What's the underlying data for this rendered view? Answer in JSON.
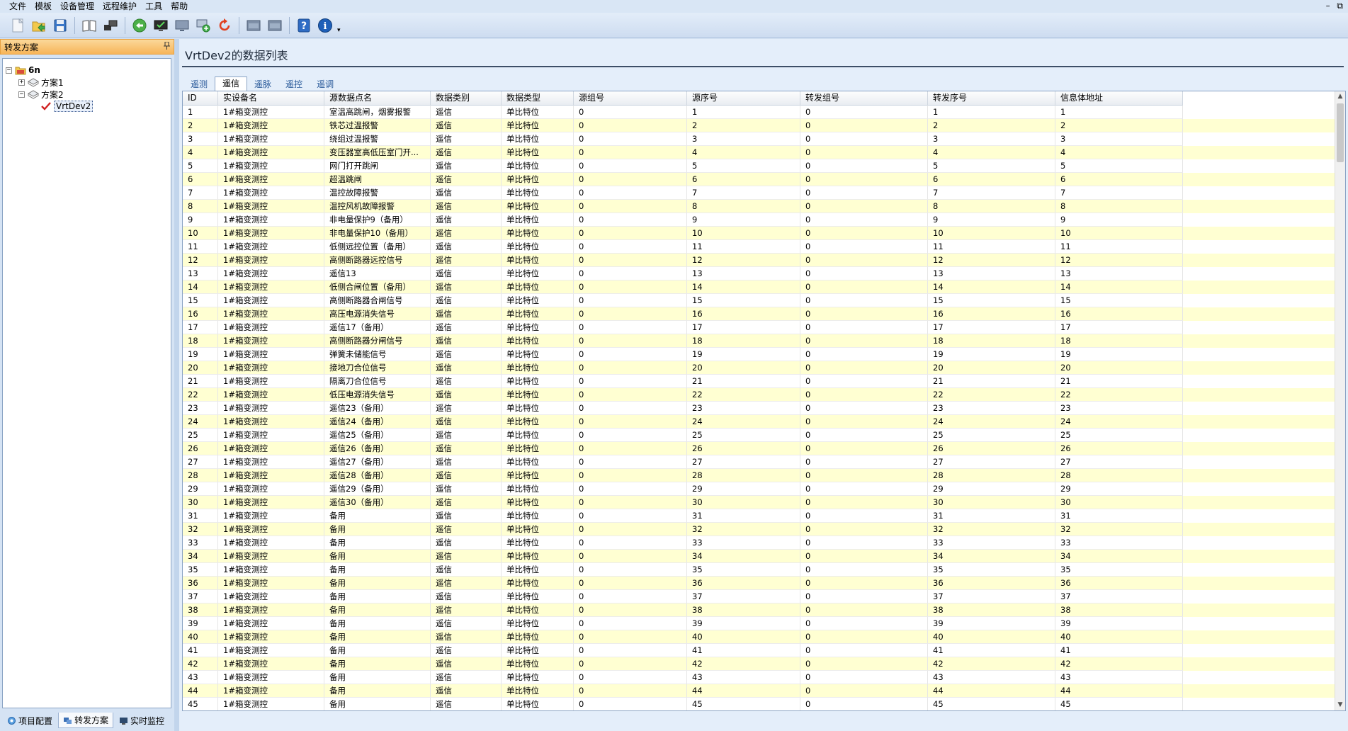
{
  "menu": [
    "文件",
    "模板",
    "设备管理",
    "远程维护",
    "工具",
    "帮助"
  ],
  "window_controls": [
    "–",
    "⧉"
  ],
  "left_panel": {
    "title": "转发方案",
    "pin": "ꟾ",
    "tree": [
      {
        "label": "6n",
        "level": 0,
        "expander": "−",
        "icon": "folder-icon"
      },
      {
        "label": "方案1",
        "level": 1,
        "expander": "+",
        "icon": "scheme-icon"
      },
      {
        "label": "方案2",
        "level": 1,
        "expander": "−",
        "icon": "scheme-icon"
      },
      {
        "label": "VrtDev2",
        "level": 2,
        "expander": "",
        "icon": "check-icon",
        "selected": true
      }
    ],
    "tabs": [
      {
        "label": "项目配置",
        "icon": "config-icon",
        "active": false
      },
      {
        "label": "转发方案",
        "icon": "forward-icon",
        "active": true
      },
      {
        "label": "实时监控",
        "icon": "monitor-icon",
        "active": false
      }
    ]
  },
  "main": {
    "title": "VrtDev2的数据列表",
    "tabs": [
      {
        "label": "遥测",
        "active": false
      },
      {
        "label": "遥信",
        "active": true
      },
      {
        "label": "遥脉",
        "active": false
      },
      {
        "label": "遥控",
        "active": false
      },
      {
        "label": "遥调",
        "active": false
      }
    ],
    "columns": [
      "ID",
      "实设备名",
      "源数据点名",
      "数据类别",
      "数据类型",
      "源组号",
      "源序号",
      "转发组号",
      "转发序号",
      "信息体地址"
    ],
    "rows": [
      [
        "1",
        "1#箱变测控",
        "室温高跳闸，烟雾报警",
        "遥信",
        "单比特位",
        "0",
        "1",
        "0",
        "1",
        "1"
      ],
      [
        "2",
        "1#箱变测控",
        "铁芯过温报警",
        "遥信",
        "单比特位",
        "0",
        "2",
        "0",
        "2",
        "2"
      ],
      [
        "3",
        "1#箱变测控",
        "绕组过温报警",
        "遥信",
        "单比特位",
        "0",
        "3",
        "0",
        "3",
        "3"
      ],
      [
        "4",
        "1#箱变测控",
        "变压器室高低压室门开...",
        "遥信",
        "单比特位",
        "0",
        "4",
        "0",
        "4",
        "4"
      ],
      [
        "5",
        "1#箱变测控",
        "网门打开跳闸",
        "遥信",
        "单比特位",
        "0",
        "5",
        "0",
        "5",
        "5"
      ],
      [
        "6",
        "1#箱变测控",
        "超温跳闸",
        "遥信",
        "单比特位",
        "0",
        "6",
        "0",
        "6",
        "6"
      ],
      [
        "7",
        "1#箱变测控",
        "温控故障报警",
        "遥信",
        "单比特位",
        "0",
        "7",
        "0",
        "7",
        "7"
      ],
      [
        "8",
        "1#箱变测控",
        "温控风机故障报警",
        "遥信",
        "单比特位",
        "0",
        "8",
        "0",
        "8",
        "8"
      ],
      [
        "9",
        "1#箱变测控",
        "非电量保护9（备用）",
        "遥信",
        "单比特位",
        "0",
        "9",
        "0",
        "9",
        "9"
      ],
      [
        "10",
        "1#箱变测控",
        "非电量保护10（备用）",
        "遥信",
        "单比特位",
        "0",
        "10",
        "0",
        "10",
        "10"
      ],
      [
        "11",
        "1#箱变测控",
        "低侧远控位置（备用）",
        "遥信",
        "单比特位",
        "0",
        "11",
        "0",
        "11",
        "11"
      ],
      [
        "12",
        "1#箱变测控",
        "高侧断路器远控信号",
        "遥信",
        "单比特位",
        "0",
        "12",
        "0",
        "12",
        "12"
      ],
      [
        "13",
        "1#箱变测控",
        "遥信13",
        "遥信",
        "单比特位",
        "0",
        "13",
        "0",
        "13",
        "13"
      ],
      [
        "14",
        "1#箱变测控",
        "低侧合闸位置（备用）",
        "遥信",
        "单比特位",
        "0",
        "14",
        "0",
        "14",
        "14"
      ],
      [
        "15",
        "1#箱变测控",
        "高侧断路器合闸信号",
        "遥信",
        "单比特位",
        "0",
        "15",
        "0",
        "15",
        "15"
      ],
      [
        "16",
        "1#箱变测控",
        "高压电源消失信号",
        "遥信",
        "单比特位",
        "0",
        "16",
        "0",
        "16",
        "16"
      ],
      [
        "17",
        "1#箱变测控",
        "遥信17（备用）",
        "遥信",
        "单比特位",
        "0",
        "17",
        "0",
        "17",
        "17"
      ],
      [
        "18",
        "1#箱变测控",
        "高侧断路器分闸信号",
        "遥信",
        "单比特位",
        "0",
        "18",
        "0",
        "18",
        "18"
      ],
      [
        "19",
        "1#箱变测控",
        "弹簧未储能信号",
        "遥信",
        "单比特位",
        "0",
        "19",
        "0",
        "19",
        "19"
      ],
      [
        "20",
        "1#箱变测控",
        "接地刀合位信号",
        "遥信",
        "单比特位",
        "0",
        "20",
        "0",
        "20",
        "20"
      ],
      [
        "21",
        "1#箱变测控",
        "隔离刀合位信号",
        "遥信",
        "单比特位",
        "0",
        "21",
        "0",
        "21",
        "21"
      ],
      [
        "22",
        "1#箱变测控",
        "低压电源消失信号",
        "遥信",
        "单比特位",
        "0",
        "22",
        "0",
        "22",
        "22"
      ],
      [
        "23",
        "1#箱变测控",
        "遥信23（备用）",
        "遥信",
        "单比特位",
        "0",
        "23",
        "0",
        "23",
        "23"
      ],
      [
        "24",
        "1#箱变测控",
        "遥信24（备用）",
        "遥信",
        "单比特位",
        "0",
        "24",
        "0",
        "24",
        "24"
      ],
      [
        "25",
        "1#箱变测控",
        "遥信25（备用）",
        "遥信",
        "单比特位",
        "0",
        "25",
        "0",
        "25",
        "25"
      ],
      [
        "26",
        "1#箱变测控",
        "遥信26（备用）",
        "遥信",
        "单比特位",
        "0",
        "26",
        "0",
        "26",
        "26"
      ],
      [
        "27",
        "1#箱变测控",
        "遥信27（备用）",
        "遥信",
        "单比特位",
        "0",
        "27",
        "0",
        "27",
        "27"
      ],
      [
        "28",
        "1#箱变测控",
        "遥信28（备用）",
        "遥信",
        "单比特位",
        "0",
        "28",
        "0",
        "28",
        "28"
      ],
      [
        "29",
        "1#箱变测控",
        "遥信29（备用）",
        "遥信",
        "单比特位",
        "0",
        "29",
        "0",
        "29",
        "29"
      ],
      [
        "30",
        "1#箱变测控",
        "遥信30（备用）",
        "遥信",
        "单比特位",
        "0",
        "30",
        "0",
        "30",
        "30"
      ],
      [
        "31",
        "1#箱变测控",
        "备用",
        "遥信",
        "单比特位",
        "0",
        "31",
        "0",
        "31",
        "31"
      ],
      [
        "32",
        "1#箱变测控",
        "备用",
        "遥信",
        "单比特位",
        "0",
        "32",
        "0",
        "32",
        "32"
      ],
      [
        "33",
        "1#箱变测控",
        "备用",
        "遥信",
        "单比特位",
        "0",
        "33",
        "0",
        "33",
        "33"
      ],
      [
        "34",
        "1#箱变测控",
        "备用",
        "遥信",
        "单比特位",
        "0",
        "34",
        "0",
        "34",
        "34"
      ],
      [
        "35",
        "1#箱变测控",
        "备用",
        "遥信",
        "单比特位",
        "0",
        "35",
        "0",
        "35",
        "35"
      ],
      [
        "36",
        "1#箱变测控",
        "备用",
        "遥信",
        "单比特位",
        "0",
        "36",
        "0",
        "36",
        "36"
      ],
      [
        "37",
        "1#箱变测控",
        "备用",
        "遥信",
        "单比特位",
        "0",
        "37",
        "0",
        "37",
        "37"
      ],
      [
        "38",
        "1#箱变测控",
        "备用",
        "遥信",
        "单比特位",
        "0",
        "38",
        "0",
        "38",
        "38"
      ],
      [
        "39",
        "1#箱变测控",
        "备用",
        "遥信",
        "单比特位",
        "0",
        "39",
        "0",
        "39",
        "39"
      ],
      [
        "40",
        "1#箱变测控",
        "备用",
        "遥信",
        "单比特位",
        "0",
        "40",
        "0",
        "40",
        "40"
      ],
      [
        "41",
        "1#箱变测控",
        "备用",
        "遥信",
        "单比特位",
        "0",
        "41",
        "0",
        "41",
        "41"
      ],
      [
        "42",
        "1#箱变测控",
        "备用",
        "遥信",
        "单比特位",
        "0",
        "42",
        "0",
        "42",
        "42"
      ],
      [
        "43",
        "1#箱变测控",
        "备用",
        "遥信",
        "单比特位",
        "0",
        "43",
        "0",
        "43",
        "43"
      ],
      [
        "44",
        "1#箱变测控",
        "备用",
        "遥信",
        "单比特位",
        "0",
        "44",
        "0",
        "44",
        "44"
      ],
      [
        "45",
        "1#箱变测控",
        "备用",
        "遥信",
        "单比特位",
        "0",
        "45",
        "0",
        "45",
        "45"
      ]
    ]
  },
  "colors": {
    "alt_row": "#ffffd2",
    "panel_header": "#f7b559",
    "accent_blue": "#2a5a9a"
  }
}
